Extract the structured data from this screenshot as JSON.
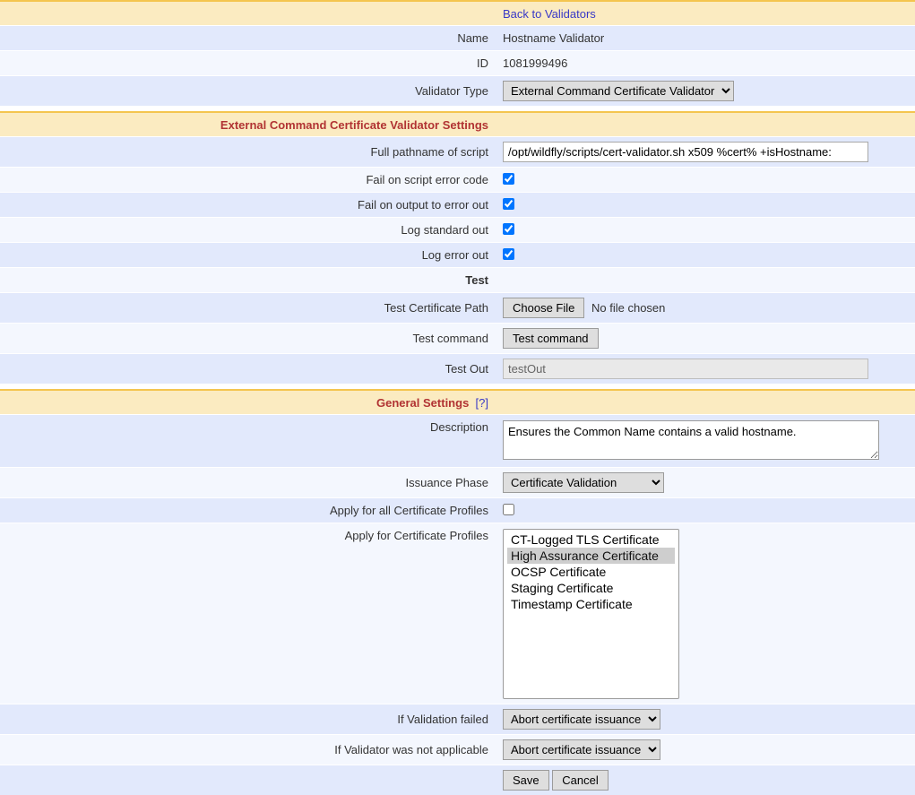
{
  "header": {
    "back_link": "Back to Validators"
  },
  "basic": {
    "name_label": "Name",
    "name_value": "Hostname Validator",
    "id_label": "ID",
    "id_value": "1081999496",
    "type_label": "Validator Type",
    "type_selected": "External Command Certificate Validator"
  },
  "ext": {
    "section_title": "External Command Certificate Validator Settings",
    "script_label": "Full pathname of script",
    "script_value": "/opt/wildfly/scripts/cert-validator.sh x509 %cert% +isHostname:",
    "fail_error_code_label": "Fail on script error code",
    "fail_stderr_label": "Fail on output to error out",
    "log_stdout_label": "Log standard out",
    "log_stderr_label": "Log error out",
    "test_heading": "Test",
    "test_cert_path_label": "Test Certificate Path",
    "choose_file_btn": "Choose File",
    "no_file_chosen": "No file chosen",
    "test_command_label": "Test command",
    "test_command_btn": "Test command",
    "test_out_label": "Test Out",
    "test_out_value": "testOut"
  },
  "general": {
    "section_title": "General Settings",
    "help_marker": "[?]",
    "description_label": "Description",
    "description_value": "Ensures the Common Name contains a valid hostname.",
    "issuance_phase_label": "Issuance Phase",
    "issuance_phase_selected": "Certificate Validation",
    "apply_all_label": "Apply for all Certificate Profiles",
    "apply_profiles_label": "Apply for Certificate Profiles",
    "profile_options": [
      "CT-Logged TLS Certificate",
      "High Assurance Certificate",
      "OCSP Certificate",
      "Staging Certificate",
      "Timestamp Certificate"
    ],
    "profile_selected_index": 1,
    "if_failed_label": "If Validation failed",
    "if_failed_selected": "Abort certificate issuance",
    "if_na_label": "If Validator was not applicable",
    "if_na_selected": "Abort certificate issuance"
  },
  "actions": {
    "save": "Save",
    "cancel": "Cancel"
  }
}
